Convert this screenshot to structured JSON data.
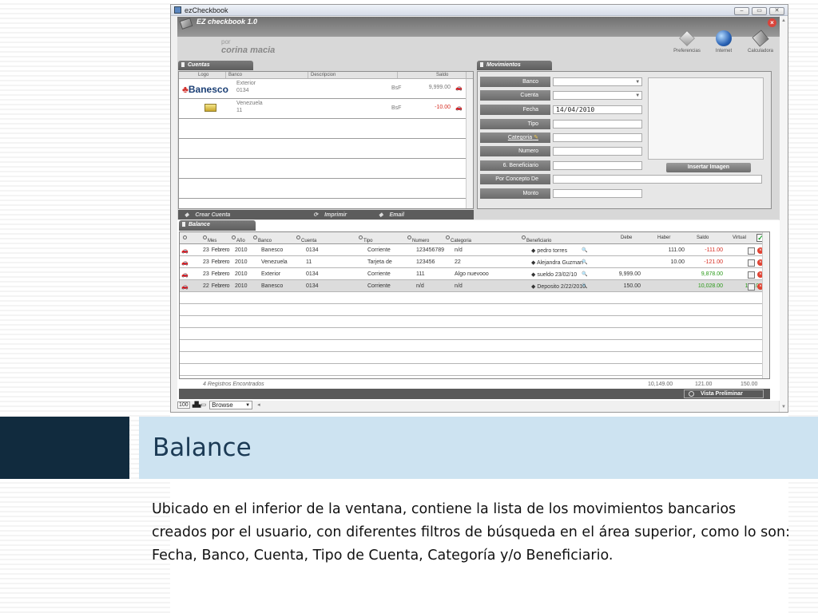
{
  "window": {
    "title": "ezCheckbook",
    "app_title": "EZ checkbook 1.0"
  },
  "user": {
    "label": "por",
    "name": "corina macia"
  },
  "toolbar": [
    {
      "label": "Preferencias",
      "icon": "preferences-icon"
    },
    {
      "label": "Internet",
      "icon": "globe-icon"
    },
    {
      "label": "Calculadora",
      "icon": "calculator-icon"
    }
  ],
  "cuentas": {
    "tab": "Cuentas",
    "headers": [
      "Logo",
      "Banco",
      "Descripcion",
      "Saldo"
    ],
    "rows": [
      {
        "logo": "Banesco",
        "banco": "Exterior",
        "num": "0134",
        "currency": "BsF",
        "saldo": "9,999.00",
        "saldo_color": "#333333"
      },
      {
        "logo": "card",
        "banco": "Venezuela",
        "num": "11",
        "currency": "BsF",
        "saldo": "-10.00",
        "saldo_color": "#d62b20"
      }
    ],
    "buttons": {
      "crear": "Crear Cuenta",
      "imprimir": "Imprimir",
      "email": "Email"
    }
  },
  "movimientos": {
    "tab": "Movimientos",
    "labels": {
      "banco": "Banco",
      "cuenta": "Cuenta",
      "fecha": "Fecha",
      "tipo": "Tipo",
      "categoria": "Categoria",
      "numero": "Numero",
      "beneficiario": "6. Beneficiario",
      "concepto": "Por Concepto De",
      "monto": "Monto"
    },
    "values": {
      "fecha": "14/04/2010"
    },
    "insertar": "Insertar Imagen"
  },
  "balance": {
    "tab": "Balance",
    "headers": [
      "Mes",
      "Año",
      "Banco",
      "Cuenta",
      "Tipo",
      "Numero",
      "Categoria",
      "Beneficiario",
      "Debe",
      "Haber",
      "Saldo",
      "Virtual"
    ],
    "rows": [
      {
        "dia": "23",
        "mes": "Febrero",
        "anio": "2010",
        "banco": "Banesco",
        "cuenta": "0134",
        "tipo": "Corriente",
        "numero": "123456789",
        "categoria": "n/d",
        "beneficiario": "pedro torres",
        "debe": "",
        "haber": "111.00",
        "saldo": "-111.00",
        "saldo_color": "red",
        "virtual": ""
      },
      {
        "dia": "23",
        "mes": "Febrero",
        "anio": "2010",
        "banco": "Venezuela",
        "cuenta": "11",
        "tipo": "Tarjeta de",
        "numero": "123456",
        "categoria": "22",
        "beneficiario": "Alejandra Guzman",
        "debe": "",
        "haber": "10.00",
        "saldo": "-121.00",
        "saldo_color": "red",
        "virtual": ""
      },
      {
        "dia": "23",
        "mes": "Febrero",
        "anio": "2010",
        "banco": "Exterior",
        "cuenta": "0134",
        "tipo": "Corriente",
        "numero": "111",
        "categoria": "Algo nuevooo",
        "beneficiario": "sueldo  23/02/10",
        "debe": "9,999.00",
        "haber": "",
        "saldo": "9,878.00",
        "saldo_color": "green",
        "virtual": ""
      },
      {
        "dia": "22",
        "mes": "Febrero",
        "anio": "2010",
        "banco": "Banesco",
        "cuenta": "0134",
        "tipo": "Corriente",
        "numero": "n/d",
        "categoria": "n/d",
        "beneficiario": "Deposito 2/22/2010",
        "debe": "150.00",
        "haber": "",
        "saldo": "10,028.00",
        "saldo_color": "green",
        "virtual": "150.00"
      }
    ],
    "footer": {
      "registros": "4  Registros Encontrados",
      "debe": "10,149.00",
      "haber": "121.00",
      "virtual": "150.00"
    },
    "vista": "Vista Preliminar"
  },
  "statusbar": {
    "zoom": "100",
    "mode": "Browse"
  },
  "slide": {
    "title": "Balance",
    "body": "Ubicado en el inferior de la ventana, contiene la lista de los movimientos bancarios creados por el usuario, con diferentes filtros de búsqueda en el área superior, como lo son: Fecha, Banco, Cuenta, Tipo de Cuenta, Categoría y/o Beneficiario."
  }
}
